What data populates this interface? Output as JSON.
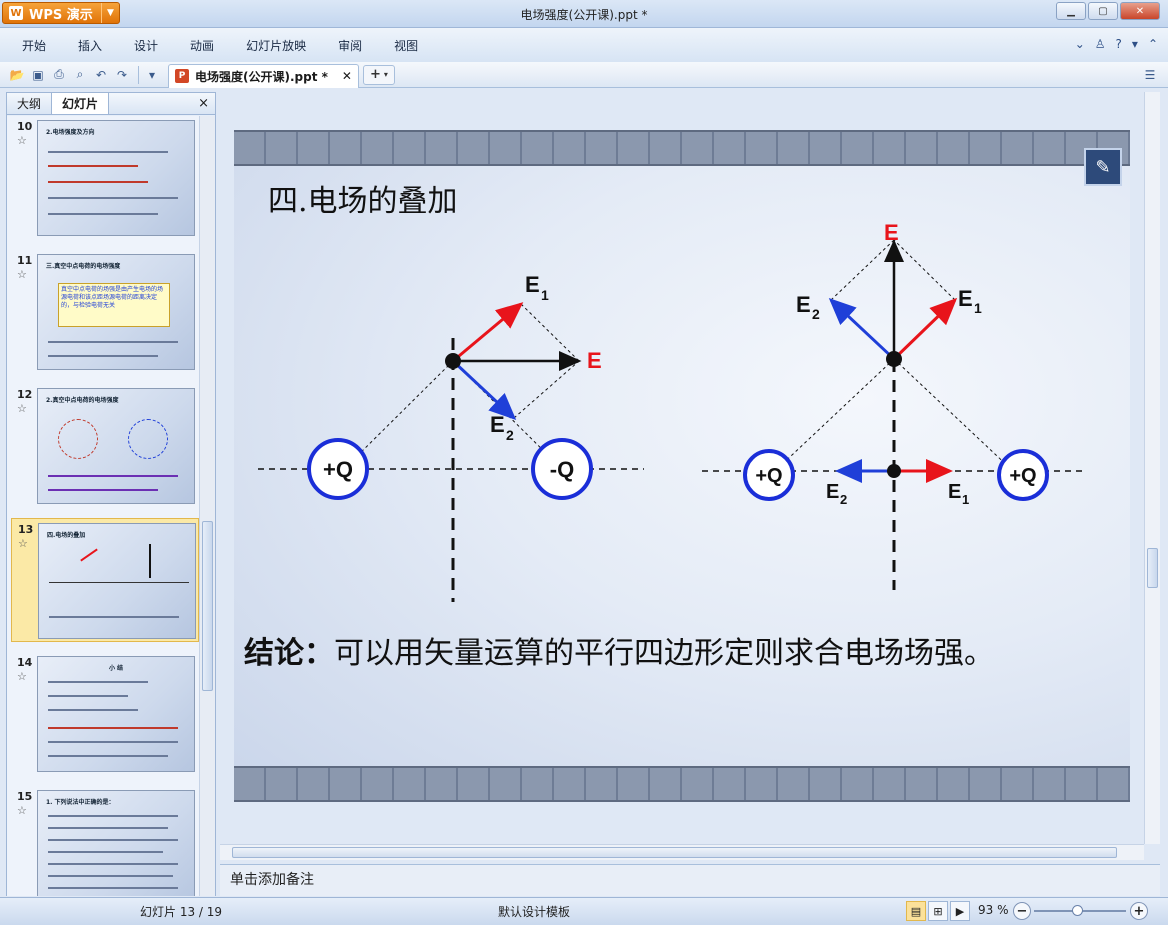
{
  "app": {
    "name": "WPS 演示",
    "window_title": "电场强度(公开课).ppt *"
  },
  "menu": [
    "开始",
    "插入",
    "设计",
    "动画",
    "幻灯片放映",
    "审阅",
    "视图"
  ],
  "document_tab": {
    "label": "电场强度(公开课).ppt *"
  },
  "panel": {
    "tabs": [
      "大纲",
      "幻灯片"
    ],
    "active_tab": "幻灯片",
    "close": "×"
  },
  "thumbnails": [
    {
      "num": "10",
      "title": "2.电场强度及方向",
      "selected": false
    },
    {
      "num": "11",
      "title": "三.真空中点电荷的电场强度",
      "note": "真空中点电荷的场强是由产生电场的场源电荷和该点距场源电荷的距离决定的，与检验电荷无关",
      "selected": false
    },
    {
      "num": "12",
      "title": "2.真空中点电荷的电场强度",
      "selected": false
    },
    {
      "num": "13",
      "title": "四.电场的叠加",
      "selected": true
    },
    {
      "num": "14",
      "title": "小 结",
      "selected": false
    },
    {
      "num": "15",
      "title": "1. 下列说法中正确的是：",
      "selected": false
    }
  ],
  "slide": {
    "title": "四.电场的叠加",
    "conclusion_label": "结论：",
    "conclusion_text": "可以用矢量运算的平行四边形定则求合电场场强。",
    "left_diagram": {
      "charge_left": "+Q",
      "charge_right": "-Q",
      "E1": "E",
      "E1_sub": "1",
      "E2": "E",
      "E2_sub": "2",
      "E": "E"
    },
    "right_diagram": {
      "charge_left": "+Q",
      "charge_right": "+Q",
      "E1": "E",
      "E1_sub": "1",
      "E2": "E",
      "E2_sub": "2",
      "E": "E",
      "E1_low": "E",
      "E1_low_sub": "1",
      "E2_low": "E",
      "E2_low_sub": "2"
    },
    "colors": {
      "E1": "#e8141b",
      "E2": "#1f3fd8",
      "E": "#111111",
      "E_label": "#e8141b",
      "charge_ring": "#1a2ed8"
    }
  },
  "notes_placeholder": "单击添加备注",
  "status": {
    "slide_indicator": "幻灯片 13 / 19",
    "template": "默认设计模板",
    "zoom": "93 %"
  }
}
